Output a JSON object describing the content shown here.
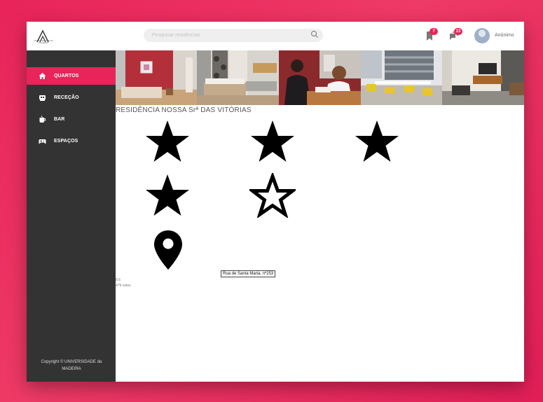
{
  "header": {
    "logo_text": "UNIVERSIDADE DA MADEIRA",
    "search_placeholder": "Pesquisar residências",
    "bookmarks_count": "7",
    "messages_count": "13",
    "username": "Anónimo"
  },
  "sidebar": {
    "items": [
      {
        "label": "QUARTOS",
        "icon": "home-icon",
        "active": true
      },
      {
        "label": "RECEÇÃO",
        "icon": "reception-icon",
        "active": false
      },
      {
        "label": "BAR",
        "icon": "drink-icon",
        "active": false
      },
      {
        "label": "ESPAÇOS",
        "icon": "gamepad-icon",
        "active": false
      }
    ],
    "copyright": "Copyright © UNIVERSIDADE da MADEIRA"
  },
  "main": {
    "gallery": [
      "bedroom-red-wall",
      "bedroom-twin-beds",
      "reception-desk",
      "cafeteria",
      "lounge"
    ],
    "title": "RESIDÊNCIA NOSSA Srª DAS VITÓRIAS",
    "stars": [
      true,
      true,
      true,
      true,
      false
    ],
    "address": "Rua de Santa Maria, nº253",
    "rating": "8.6",
    "votes": "479 votos"
  },
  "colors": {
    "accent": "#e8245a",
    "sidebar_bg": "#333333"
  }
}
